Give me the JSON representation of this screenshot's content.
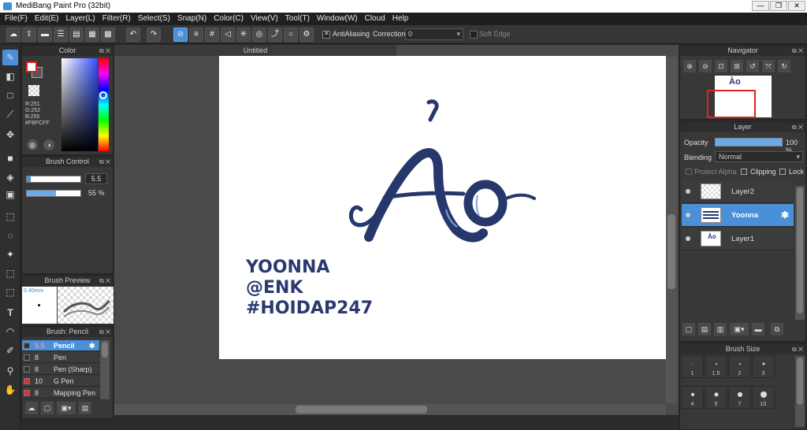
{
  "window": {
    "title": "MediBang Paint Pro (32bit)",
    "minimize": "—",
    "restore": "❐",
    "close": "✕"
  },
  "menu": [
    "File(F)",
    "Edit(E)",
    "Layer(L)",
    "Filter(R)",
    "Select(S)",
    "Snap(N)",
    "Color(C)",
    "View(V)",
    "Tool(T)",
    "Window(W)",
    "Cloud",
    "Help"
  ],
  "toolbar": {
    "antialiasing_label": "AntiAliasing",
    "correction_label": "Correction",
    "correction_value": "0",
    "soft_edge_label": "Soft Edge"
  },
  "color_panel": {
    "title": "Color",
    "r": "R:251",
    "g": "G:252",
    "b": "B:255",
    "hex": "#FBFCFF",
    "fg_color": "#ffffff",
    "bg_color": "#e02020"
  },
  "brush_control": {
    "title": "Brush Control",
    "size_value": "5.5",
    "opacity_value": "55 %"
  },
  "brush_preview": {
    "title": "Brush Preview",
    "size_label": "0.40mm"
  },
  "brush_list": {
    "title": "Brush: Pencil",
    "items": [
      {
        "size": "5.5",
        "name": "Pencil",
        "color": "#333333"
      },
      {
        "size": "8",
        "name": "Pen",
        "color": "#333333"
      },
      {
        "size": "8",
        "name": "Pen (Sharp)",
        "color": "#333333"
      },
      {
        "size": "10",
        "name": "G Pen",
        "color": "#e03030"
      },
      {
        "size": "8",
        "name": "Mapping Pen",
        "color": "#e03030"
      }
    ]
  },
  "canvas": {
    "tab_title": "Untitled",
    "text_line1": "YOONNA",
    "text_line2": "@ENK",
    "text_line3": "#HOIDAP247",
    "lettering": "Ào"
  },
  "navigator": {
    "title": "Navigator"
  },
  "layer_panel": {
    "title": "Layer",
    "opacity_label": "Opacity",
    "opacity_value": "100 %",
    "opacity_fraction": 1.0,
    "blending_label": "Blending",
    "blending_value": "Normal",
    "protect_alpha_label": "Protect Alpha",
    "clipping_label": "Clipping",
    "lock_label": "Lock",
    "layers": [
      {
        "name": "Layer2"
      },
      {
        "name": "Yoonna"
      },
      {
        "name": "Layer1"
      }
    ]
  },
  "brush_size": {
    "title": "Brush Size",
    "sizes": [
      "1",
      "1.5",
      "2",
      "3",
      "4",
      "5",
      "7",
      "10"
    ]
  }
}
